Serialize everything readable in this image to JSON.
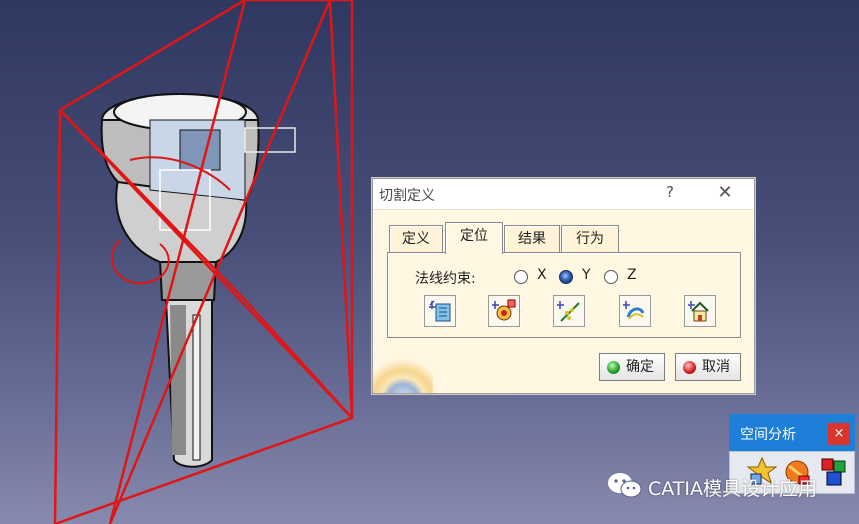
{
  "dialog": {
    "title": "切割定义",
    "help": "?",
    "close": "✕",
    "tabs": [
      {
        "label": "定义",
        "active": false
      },
      {
        "label": "定位",
        "active": true
      },
      {
        "label": "结果",
        "active": false
      },
      {
        "label": "行为",
        "active": false
      }
    ],
    "normal_constraint_label": "法线约束:",
    "radio_options": [
      {
        "label": "X",
        "checked": false
      },
      {
        "label": "Y",
        "checked": true
      },
      {
        "label": "Z",
        "checked": false
      }
    ],
    "positioning_tools": [
      {
        "icon": "edit-position-icon"
      },
      {
        "icon": "position-on-point-icon"
      },
      {
        "icon": "position-on-line-icon"
      },
      {
        "icon": "reverse-normal-icon"
      },
      {
        "icon": "reset-position-home-icon"
      }
    ],
    "ok_label": "确定",
    "cancel_label": "取消"
  },
  "spatial_toolbar": {
    "title": "空间分析",
    "close": "×",
    "icons": [
      "clash-analysis-icon",
      "sectioning-icon",
      "distance-band-icon"
    ]
  },
  "watermark": {
    "text": "CATIA模具设计应用"
  },
  "colors": {
    "dialog_bg": "#fff7e2",
    "toolbar_title": "#1e7fd8",
    "section_plane": "#e01515",
    "viewport_top": "#2f3860",
    "viewport_bottom": "#878aae"
  }
}
